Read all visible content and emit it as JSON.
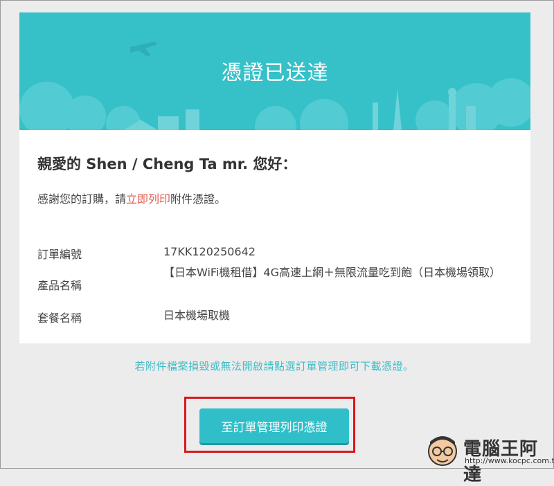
{
  "banner": {
    "title": "憑證已送達"
  },
  "greeting": "親愛的 Shen / Cheng Ta mr. 您好：",
  "thanks": {
    "before": "感謝您的訂購，請",
    "link": "立即列印",
    "after": "附件憑證。"
  },
  "details": [
    {
      "label": "訂單編號",
      "value": "17KK120250642"
    },
    {
      "label": "產品名稱",
      "value": "【日本WiFi機租借】4G高速上網＋無限流量吃到飽（日本機場領取）"
    },
    {
      "label": "套餐名稱",
      "value": "日本機場取機"
    }
  ],
  "note": "若附件檔案損毀或無法開啟請點選訂單管理即可下載憑證。",
  "button": {
    "label": "至訂單管理列印憑證"
  },
  "watermark": {
    "text": "電腦王阿達",
    "url": "http://www.kocpc.com.tw"
  },
  "colors": {
    "teal": "#36c1c9",
    "link_red": "#e05a4f",
    "highlight_red": "#d8181c"
  }
}
